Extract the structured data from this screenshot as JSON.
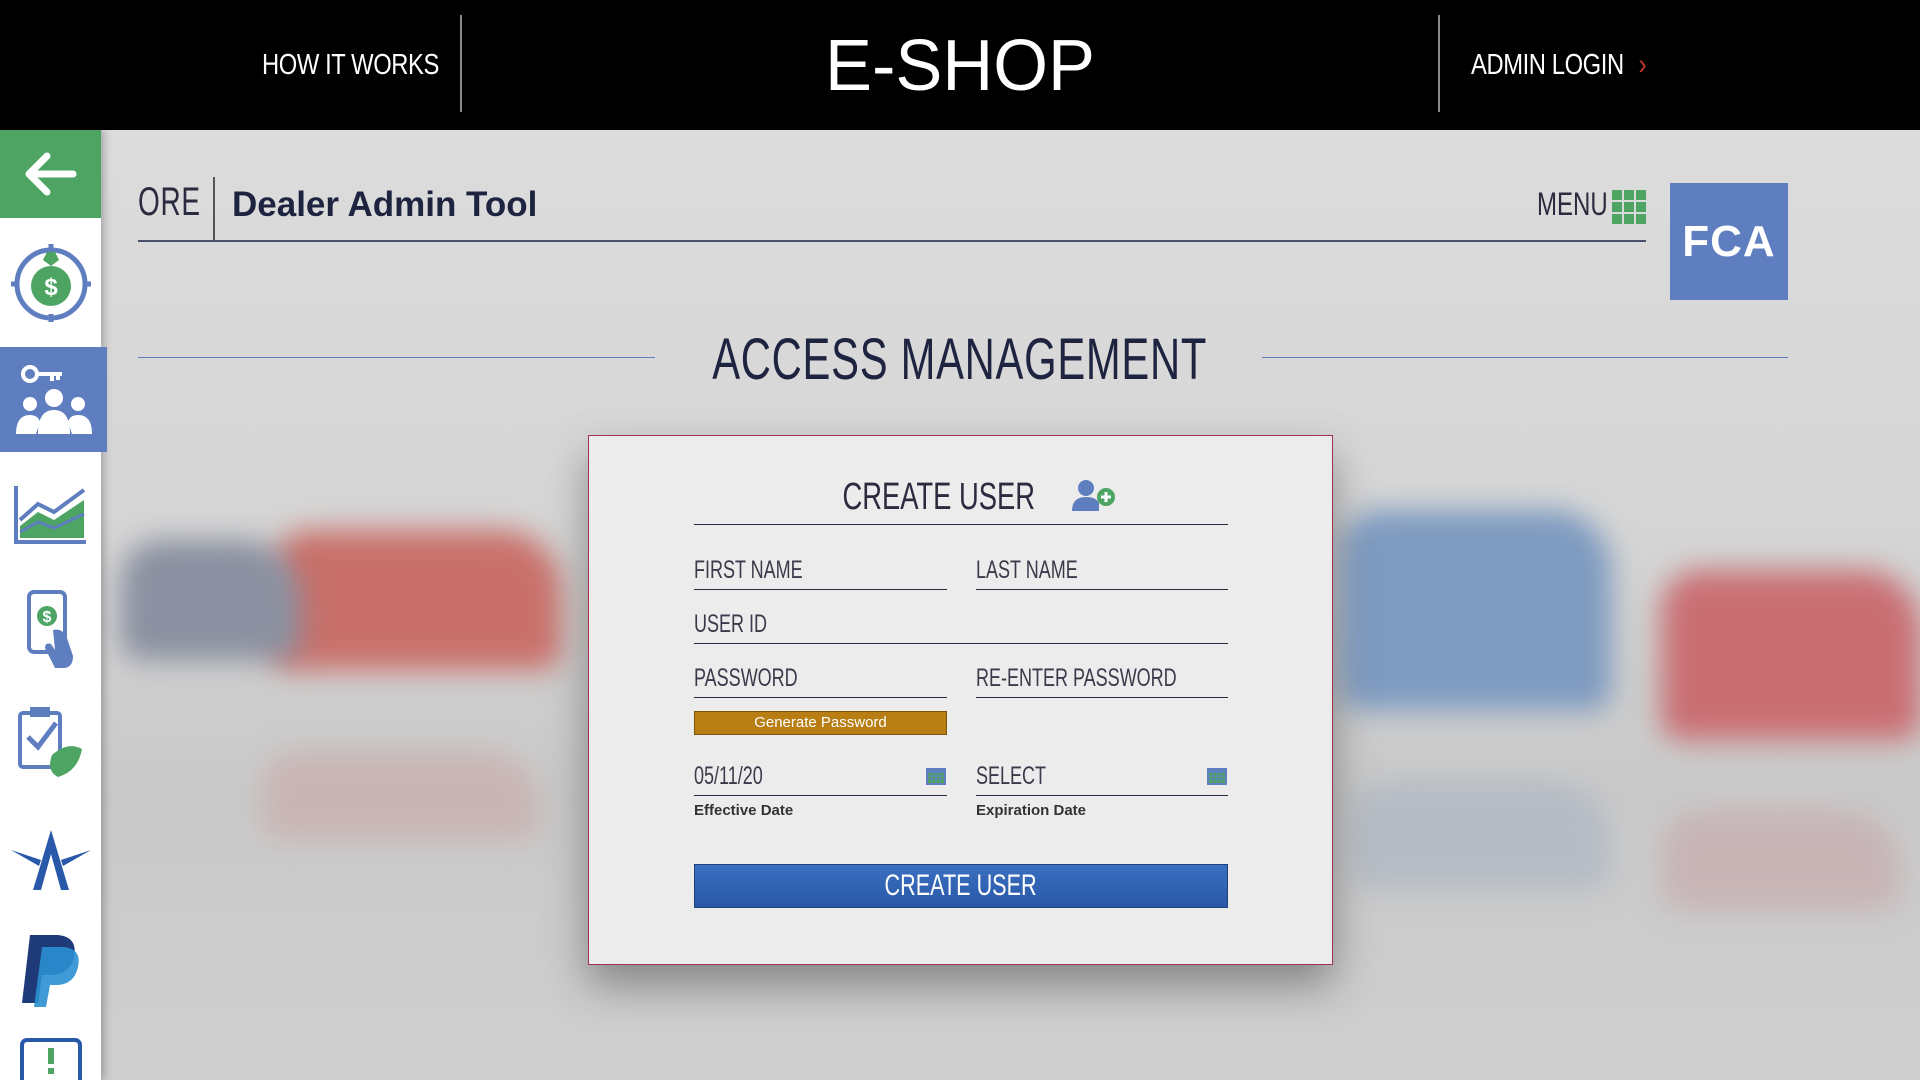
{
  "topbar": {
    "how_it_works": "HOW IT WORKS",
    "logo_text": "E-SHOP",
    "admin_login": "ADMIN LOGIN"
  },
  "header": {
    "ore": "ORE",
    "title": "Dealer Admin Tool",
    "menu": "MENU",
    "brand_logo": "FCA"
  },
  "section": {
    "title": "ACCESS MANAGEMENT"
  },
  "form": {
    "title": "CREATE USER",
    "first_name_placeholder": "FIRST NAME",
    "last_name_placeholder": "LAST NAME",
    "user_id_placeholder": "USER ID",
    "password_placeholder": "PASSWORD",
    "reenter_password_placeholder": "RE-ENTER PASSWORD",
    "generate_password": "Generate Password",
    "effective_date_value": "05/11/20",
    "effective_date_label": "Effective Date",
    "expiration_date_value": "SELECT",
    "expiration_date_label": "Expiration Date",
    "submit": "CREATE USER"
  },
  "sidebar": {
    "items": [
      {
        "icon": "back-arrow-icon",
        "active": false
      },
      {
        "icon": "money-bag-target-icon",
        "active": false
      },
      {
        "icon": "users-key-icon",
        "active": true
      },
      {
        "icon": "area-chart-icon",
        "active": false
      },
      {
        "icon": "mobile-payment-icon",
        "active": false
      },
      {
        "icon": "clipboard-check-icon",
        "active": false
      },
      {
        "icon": "star-a-logo-icon",
        "active": false
      },
      {
        "icon": "paypal-icon",
        "active": false
      },
      {
        "icon": "alert-icon",
        "active": false
      }
    ]
  },
  "colors": {
    "accent_green": "#4da463",
    "accent_blue": "#5f7ec0",
    "button_blue": "#2a58a8",
    "button_gold": "#b87e14",
    "card_border": "#a3334a"
  }
}
